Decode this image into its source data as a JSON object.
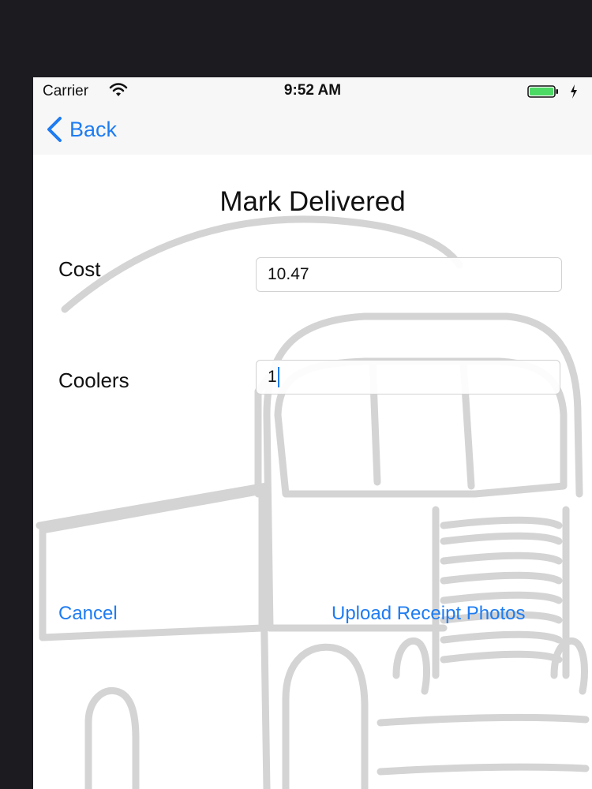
{
  "status_bar": {
    "carrier": "Carrier",
    "time": "9:52 AM",
    "wifi_icon": "wifi-icon",
    "battery_icon": "battery-icon"
  },
  "nav": {
    "back_label": "Back",
    "back_icon": "chevron-left-icon"
  },
  "screen": {
    "title": "Mark Delivered"
  },
  "form": {
    "cost_label": "Cost",
    "cost_value": "10.47",
    "coolers_label": "Coolers",
    "coolers_value": "1"
  },
  "actions": {
    "cancel_label": "Cancel",
    "upload_label": "Upload Receipt Photos"
  },
  "colors": {
    "accent": "#1e7cf2",
    "battery": "#4cd964",
    "outer_background": "#1c1b20",
    "truck_outline": "#cfcfcf"
  }
}
